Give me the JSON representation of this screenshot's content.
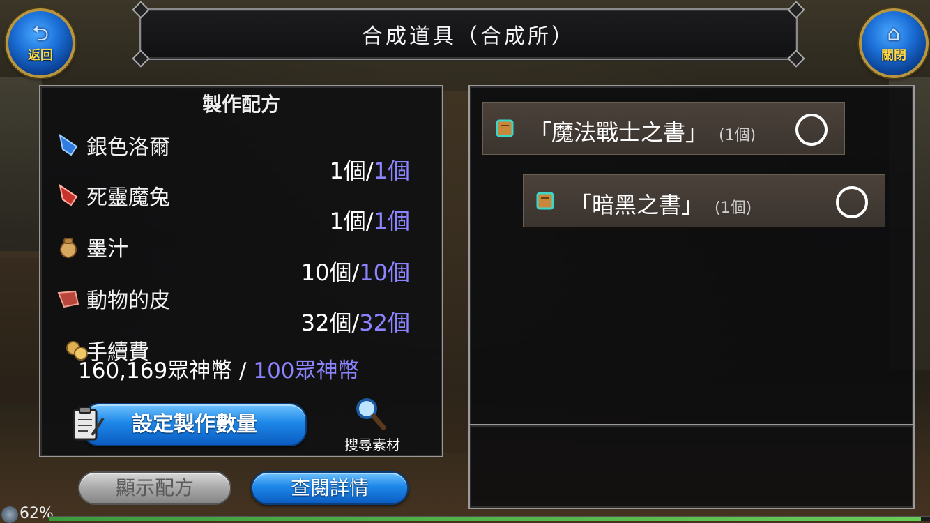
{
  "header": {
    "title": "合成道具（合成所）",
    "back_label": "返回",
    "close_label": "關閉"
  },
  "recipe": {
    "title": "製作配方",
    "materials": [
      {
        "name": "銀色洛爾",
        "owned": "1個",
        "needed": "1個",
        "icon": "blue-crystal-icon"
      },
      {
        "name": "死靈魔兔",
        "owned": "1個",
        "needed": "1個",
        "icon": "red-crystal-icon"
      },
      {
        "name": "墨汁",
        "owned": "10個",
        "needed": "10個",
        "icon": "ink-pouch-icon"
      },
      {
        "name": "動物的皮",
        "owned": "32個",
        "needed": "32個",
        "icon": "animal-hide-icon"
      }
    ],
    "fee": {
      "label": "手續費",
      "owned": "160,169眾神幣",
      "separator": " / ",
      "needed": "100眾神幣"
    },
    "set_quantity_label": "設定製作數量",
    "search_label": "搜尋素材"
  },
  "bottom_buttons": {
    "show_recipe": "顯示配方",
    "view_details": "查閱詳情"
  },
  "results": [
    {
      "name": "「魔法戰士之書」",
      "qty": "(1個)"
    },
    {
      "name": "「暗黑之書」",
      "qty": "(1個)"
    }
  ],
  "status": {
    "battery": "62%",
    "exp_fraction": 0.99
  },
  "colors": {
    "needed_text": "#8c84ff",
    "button_blue": "#1d87e8",
    "frame": "#9a9a9a"
  }
}
